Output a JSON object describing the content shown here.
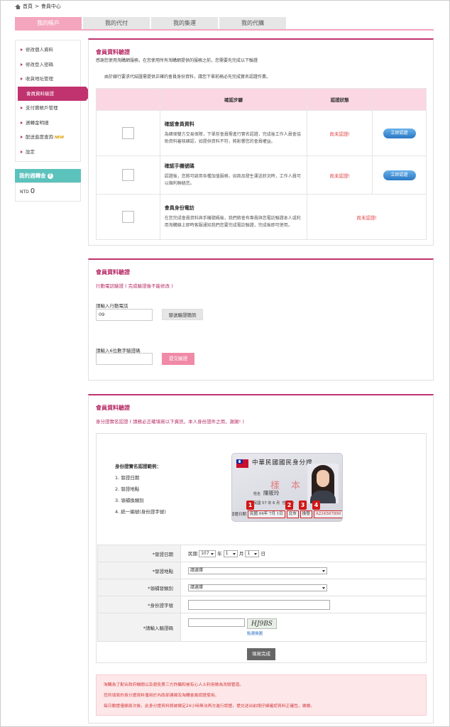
{
  "breadcrumb": {
    "home": "首頁",
    "sep": ">",
    "current": "會員中心"
  },
  "tabs": [
    {
      "label": "我的帳戶"
    },
    {
      "label": "我的代付"
    },
    {
      "label": "我的集運"
    },
    {
      "label": "我的代購"
    }
  ],
  "sidebar": {
    "items": [
      {
        "label": "修改個人資料"
      },
      {
        "label": "修改登入密碼"
      },
      {
        "label": "收貨地址管理"
      },
      {
        "label": "會員資料驗證"
      },
      {
        "label": "支付寶帳戶管理"
      },
      {
        "label": "週轉金明細"
      },
      {
        "label": "配送進度查詢",
        "badge": "NEW"
      },
      {
        "label": "設定"
      }
    ],
    "bonus_title": "我的週轉金",
    "bonus_help": "?",
    "bonus_currency": "NTD",
    "bonus_value": "0"
  },
  "panel1": {
    "title": "會員資料驗證",
    "subtitle": "感謝您使用淘購網服務，在您使用所有淘購網提供的服務之前，您需要先完成以下驗證",
    "notice": "由於銀行要求代結匯需提供正確的會員身份資料，請您下單前務必先完成實名認證作業。",
    "col_step": "確認步驟",
    "col_status": "認證狀態",
    "rows": [
      {
        "title": "確認會員資料",
        "desc": "為確保雙方交易保障，下單前會員需進行實名認證，完成後工作人員會協助資料審核確認，如提供資料不符，將影響您的會員權益。",
        "status": "尚未認證!",
        "button": "立即認證"
      },
      {
        "title": "確認手機號碼",
        "desc": "認證後，您將可啟用各種加值服務，如商品發生運送狀況時，工作人員可以順利聯絡您。",
        "status": "尚未認證!",
        "button": "立即認證"
      },
      {
        "title": "會員身份電訪",
        "desc": "在您完成會員資料與手機號碼後，我們將會有專員與您電訪驗證本人或利用淘購線上即時客服通知我們您要完成電訪驗證，完成後即可使用。",
        "status": "尚未認證!"
      }
    ]
  },
  "panel2": {
    "title": "會員資料驗證",
    "subtitle": "行動電話驗證 ( 完成驗證後不能修改 )",
    "phone_label": "請輸入行動電話",
    "phone_value": "09",
    "send_button": "發送驗證簡訊",
    "code_label": "請輸入6位數字驗證碼",
    "code_value": "",
    "submit_button": "提交驗證"
  },
  "panel3": {
    "title": "會員資料驗證",
    "subtitle": "身分證實名認證 ( 請務必正確填寫以下資訊，本人身份證件之用，謝謝! )",
    "sample_title": "身份證實名認證範例：",
    "sample_items": [
      "1. 發證日期",
      "2. 發證地點",
      "3. 領補換類別",
      "4. 統一編號(身份證字號)"
    ],
    "card": {
      "title": "中華民國國民身分證",
      "stamp": "樣本",
      "name_label": "姓名",
      "name": "陳筱玲",
      "birth": "民國 57 年 6 月",
      "gender": "性別 女",
      "issue_label": "發證日期",
      "issue_date": "民國 94年 7月 1日",
      "issue_place": "北市",
      "issue_type": "換發",
      "id_number": "A234567890",
      "badges": [
        "1",
        "2",
        "3",
        "4"
      ]
    },
    "form": {
      "issue_date_label": "*發證日期",
      "era": "民國",
      "year": "107",
      "year_unit": "年",
      "month": "1",
      "month_unit": "月",
      "day": "1",
      "day_unit": "日",
      "place_label": "*發證地點",
      "place_value": "請選擇",
      "type_label": "*領補發類別",
      "type_value": "請選擇",
      "id_label": "*身份證字號",
      "id_value": "",
      "captcha_label": "*請輸入驗證碼",
      "captcha_value": "",
      "captcha_image": "HJ9BS",
      "captcha_refresh": "點選換圖",
      "submit": "填寫完成"
    },
    "notice_lines": [
      "淘購為了配合政府機關以及避免第三方詐騙和被有心人士利用做為洗錢管道。",
      "您所填寫的身分證資料僅用於內政部連線及淘購會員認證使用。",
      "每日驗證僅錄兩次後，此身分證資料將被鎖定24小時無法再次進行認證，提交送出前請仔細確認資料正確性，謝謝。"
    ]
  },
  "colors": {
    "accent": "#c0336e",
    "tab_active": "#f4a6be",
    "bonus": "#5cc2bc",
    "button_blue": "#2a78c4"
  }
}
